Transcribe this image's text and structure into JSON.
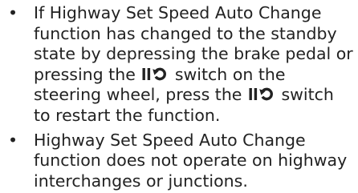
{
  "bullets": [
    {
      "marker": "•",
      "text_before": "If Highway Set Speed Auto Change function has changed to the standby state by depressing the brake pedal or pressing the ",
      "text_middle": " switch on the steering wheel, press the ",
      "text_after": " switch to restart the function."
    },
    {
      "marker": "•",
      "text": "Highway Set Speed Auto Change function does not operate on highway interchanges or junctions."
    }
  ],
  "icons": {
    "switch": "pause-resume-icon",
    "color": "#222222"
  }
}
